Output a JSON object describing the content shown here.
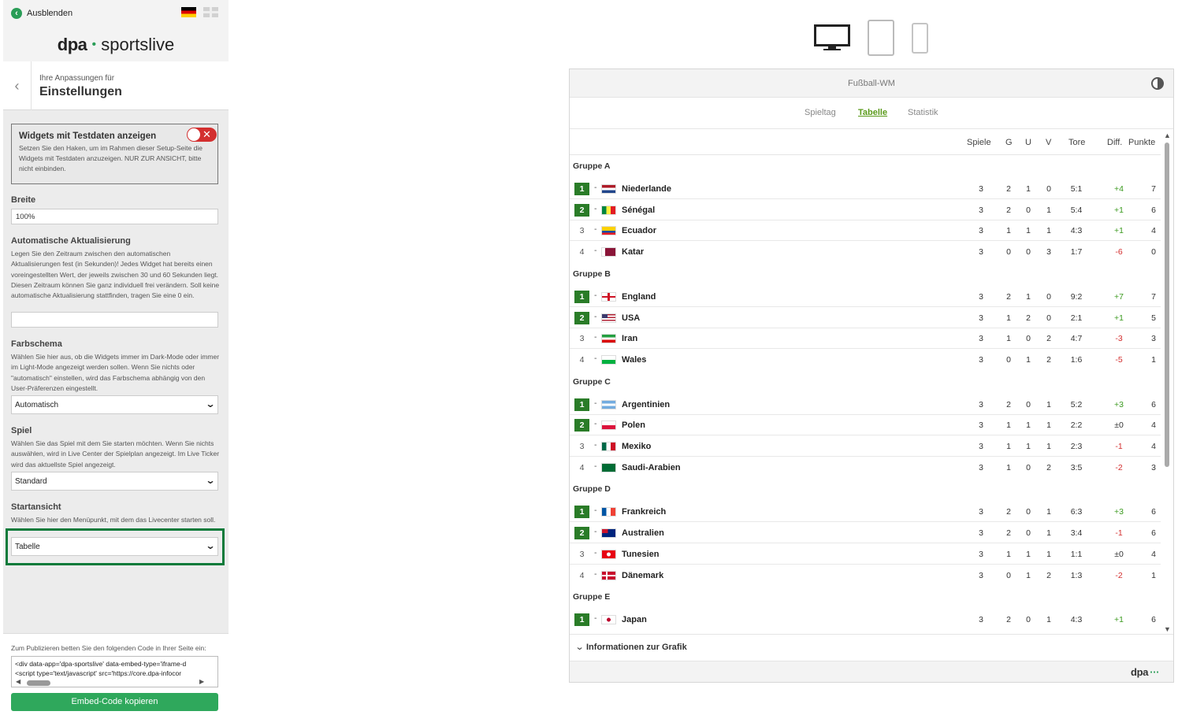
{
  "sidebar": {
    "hide_label": "Ausblenden",
    "logo_dpa": "dpa",
    "logo_sports": "sportslive",
    "settings_subtitle": "Ihre Anpassungen für",
    "settings_title": "Einstellungen",
    "test_widget_title": "Widgets mit Testdaten anzeigen",
    "test_widget_desc": "Setzen Sie den Haken, um im Rahmen dieser Setup-Seite die Widgets mit Testdaten anzuzeigen. NUR ZUR ANSICHT, bitte nicht einbinden.",
    "test_widget_enabled": false,
    "width_label": "Breite",
    "width_value": "100%",
    "refresh_label": "Automatische Aktualisierung",
    "refresh_desc": "Legen Sie den Zeitraum zwischen den automatischen Aktualisierungen fest (in Sekunden)! Jedes Widget hat bereits einen voreingestellten Wert, der jeweils zwischen 30 und 60 Sekunden liegt. Diesen Zeitraum können Sie ganz individuell frei verändern. Soll keine automatische Aktualisierung stattfinden, tragen Sie eine 0 ein.",
    "refresh_value": "",
    "scheme_label": "Farbschema",
    "scheme_desc": "Wählen Sie hier aus, ob die Widgets immer im Dark-Mode oder immer im Light-Mode angezeigt werden sollen. Wenn Sie nichts oder \"automatisch\" einstellen, wird das Farbschema abhängig von den User-Präferenzen eingestellt.",
    "scheme_value": "Automatisch",
    "game_label": "Spiel",
    "game_desc": "Wählen Sie das Spiel mit dem Sie starten möchten. Wenn Sie nichts auswählen, wird in Live Center der Spielplan angezeigt. Im Live Ticker wird das aktuellste Spiel angezeigt.",
    "game_value": "Standard",
    "start_label": "Startansicht",
    "start_desc": "Wählen Sie hier den Menüpunkt, mit dem das Livecenter starten soll.",
    "start_value": "Tabelle",
    "publish_desc": "Zum Publizieren betten Sie den folgenden Code in Ihrer Seite ein:",
    "code_line1": "<div data-app='dpa-sportslive' data-embed-type='iframe-d",
    "code_line2": "<script type='text/javascript' src='https://core.dpa-infocor",
    "copy_button": "Embed-Code kopieren"
  },
  "colors": {
    "accent_green": "#2fa85c",
    "qualified_green": "#2a7c28",
    "active_tab": "#5b9b1b",
    "positive": "#3b9a1f",
    "negative": "#d32f2f",
    "highlight_border": "#0a7a3a"
  },
  "devices": [
    "desktop-icon",
    "tablet-icon",
    "phone-icon"
  ],
  "widget": {
    "title": "Fußball-WM",
    "tabs": [
      "Spieltag",
      "Tabelle",
      "Statistik"
    ],
    "active_tab": "Tabelle",
    "columns": [
      "Spiele",
      "G",
      "U",
      "V",
      "Tore",
      "Diff.",
      "Punkte"
    ],
    "info_label": "Informationen zur Grafik",
    "footer_logo": "dpa",
    "groups": [
      {
        "name": "Gruppe A",
        "rows": [
          {
            "rank": "1",
            "trend": "-",
            "team": "Niederlande",
            "flag": "nl",
            "sp": "3",
            "g": "2",
            "u": "1",
            "v": "0",
            "tore": "5:1",
            "diff": "+4",
            "pkt": "7"
          },
          {
            "rank": "2",
            "trend": "-",
            "team": "Sénégal",
            "flag": "sn",
            "sp": "3",
            "g": "2",
            "u": "0",
            "v": "1",
            "tore": "5:4",
            "diff": "+1",
            "pkt": "6"
          },
          {
            "rank": "3",
            "trend": "-",
            "team": "Ecuador",
            "flag": "ec",
            "sp": "3",
            "g": "1",
            "u": "1",
            "v": "1",
            "tore": "4:3",
            "diff": "+1",
            "pkt": "4"
          },
          {
            "rank": "4",
            "trend": "-",
            "team": "Katar",
            "flag": "qa",
            "sp": "3",
            "g": "0",
            "u": "0",
            "v": "3",
            "tore": "1:7",
            "diff": "-6",
            "pkt": "0"
          }
        ]
      },
      {
        "name": "Gruppe B",
        "rows": [
          {
            "rank": "1",
            "trend": "-",
            "team": "England",
            "flag": "en",
            "sp": "3",
            "g": "2",
            "u": "1",
            "v": "0",
            "tore": "9:2",
            "diff": "+7",
            "pkt": "7"
          },
          {
            "rank": "2",
            "trend": "-",
            "team": "USA",
            "flag": "us",
            "sp": "3",
            "g": "1",
            "u": "2",
            "v": "0",
            "tore": "2:1",
            "diff": "+1",
            "pkt": "5"
          },
          {
            "rank": "3",
            "trend": "-",
            "team": "Iran",
            "flag": "ir",
            "sp": "3",
            "g": "1",
            "u": "0",
            "v": "2",
            "tore": "4:7",
            "diff": "-3",
            "pkt": "3"
          },
          {
            "rank": "4",
            "trend": "-",
            "team": "Wales",
            "flag": "wl",
            "sp": "3",
            "g": "0",
            "u": "1",
            "v": "2",
            "tore": "1:6",
            "diff": "-5",
            "pkt": "1"
          }
        ]
      },
      {
        "name": "Gruppe C",
        "rows": [
          {
            "rank": "1",
            "trend": "-",
            "team": "Argentinien",
            "flag": "ar",
            "sp": "3",
            "g": "2",
            "u": "0",
            "v": "1",
            "tore": "5:2",
            "diff": "+3",
            "pkt": "6"
          },
          {
            "rank": "2",
            "trend": "-",
            "team": "Polen",
            "flag": "pl",
            "sp": "3",
            "g": "1",
            "u": "1",
            "v": "1",
            "tore": "2:2",
            "diff": "±0",
            "pkt": "4"
          },
          {
            "rank": "3",
            "trend": "-",
            "team": "Mexiko",
            "flag": "mx",
            "sp": "3",
            "g": "1",
            "u": "1",
            "v": "1",
            "tore": "2:3",
            "diff": "-1",
            "pkt": "4"
          },
          {
            "rank": "4",
            "trend": "-",
            "team": "Saudi-Arabien",
            "flag": "sa",
            "sp": "3",
            "g": "1",
            "u": "0",
            "v": "2",
            "tore": "3:5",
            "diff": "-2",
            "pkt": "3"
          }
        ]
      },
      {
        "name": "Gruppe D",
        "rows": [
          {
            "rank": "1",
            "trend": "-",
            "team": "Frankreich",
            "flag": "fr",
            "sp": "3",
            "g": "2",
            "u": "0",
            "v": "1",
            "tore": "6:3",
            "diff": "+3",
            "pkt": "6"
          },
          {
            "rank": "2",
            "trend": "-",
            "team": "Australien",
            "flag": "au",
            "sp": "3",
            "g": "2",
            "u": "0",
            "v": "1",
            "tore": "3:4",
            "diff": "-1",
            "pkt": "6"
          },
          {
            "rank": "3",
            "trend": "-",
            "team": "Tunesien",
            "flag": "tn",
            "sp": "3",
            "g": "1",
            "u": "1",
            "v": "1",
            "tore": "1:1",
            "diff": "±0",
            "pkt": "4"
          },
          {
            "rank": "4",
            "trend": "-",
            "team": "Dänemark",
            "flag": "dk",
            "sp": "3",
            "g": "0",
            "u": "1",
            "v": "2",
            "tore": "1:3",
            "diff": "-2",
            "pkt": "1"
          }
        ]
      },
      {
        "name": "Gruppe E",
        "rows": [
          {
            "rank": "1",
            "trend": "-",
            "team": "Japan",
            "flag": "jp",
            "sp": "3",
            "g": "2",
            "u": "0",
            "v": "1",
            "tore": "4:3",
            "diff": "+1",
            "pkt": "6"
          }
        ]
      }
    ]
  }
}
